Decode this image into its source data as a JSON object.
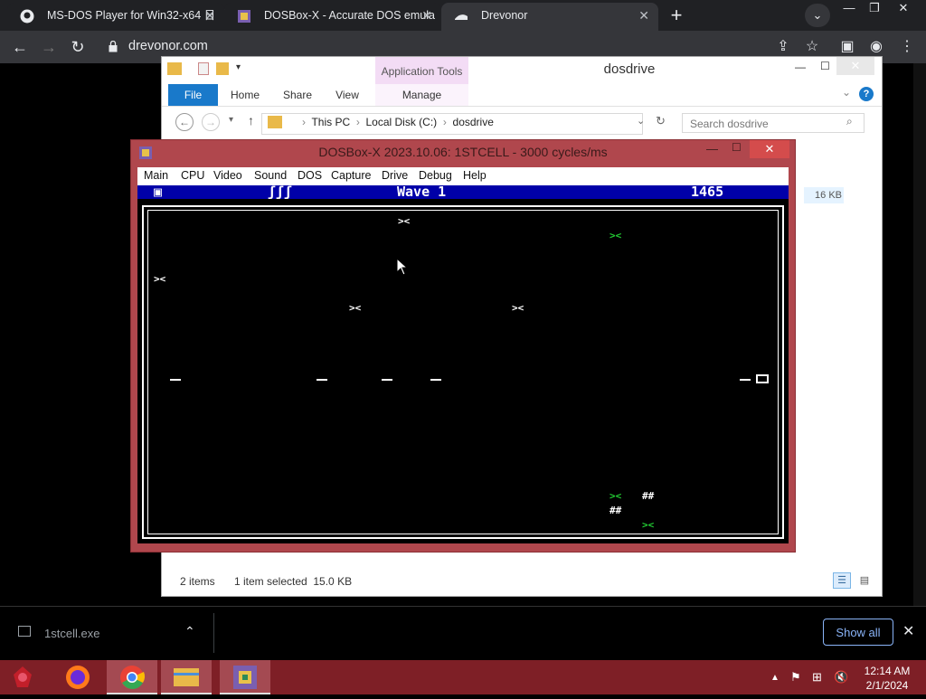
{
  "browser": {
    "tabs": [
      {
        "title": "MS-DOS Player for Win32-x64 日",
        "active": false
      },
      {
        "title": "DOSBox-X - Accurate DOS emula",
        "active": false
      },
      {
        "title": "Drevonor",
        "active": true
      }
    ],
    "new_tab_icon": "plus-icon",
    "url": "drevonor.com",
    "colors": {
      "tabstrip": "#202124",
      "active_tab": "#35363a"
    }
  },
  "explorer": {
    "title": "dosdrive",
    "app_tools": "Application Tools",
    "ribbon_tabs": [
      "File",
      "Home",
      "Share",
      "View",
      "Manage"
    ],
    "breadcrumb": [
      "This PC",
      "Local Disk (C:)",
      "dosdrive"
    ],
    "search_placeholder": "Search dosdrive",
    "file_size": "16 KB",
    "status_items": "2 items",
    "status_selected": "1 item selected  15.0 KB"
  },
  "dosbox": {
    "title": "DOSBox-X 2023.10.06: 1STCELL - 3000 cycles/ms",
    "menu": [
      "Main",
      "CPU",
      "Video",
      "Sound",
      "DOS",
      "Capture",
      "Drive",
      "Debug",
      "Help"
    ],
    "hud": {
      "icon": "▣",
      "lives": "ʃʃʃ",
      "wave": "Wave 1",
      "score": "1465"
    },
    "colors": {
      "frame": "#b0474d",
      "hud_bg": "#0000a8",
      "enemy_green": "#22cc33"
    }
  },
  "download": {
    "filename": "1stcell.exe",
    "show_all": "Show all"
  },
  "taskbar": {
    "time": "12:14 AM",
    "date": "2/1/2024",
    "color": "#7e1f26"
  }
}
